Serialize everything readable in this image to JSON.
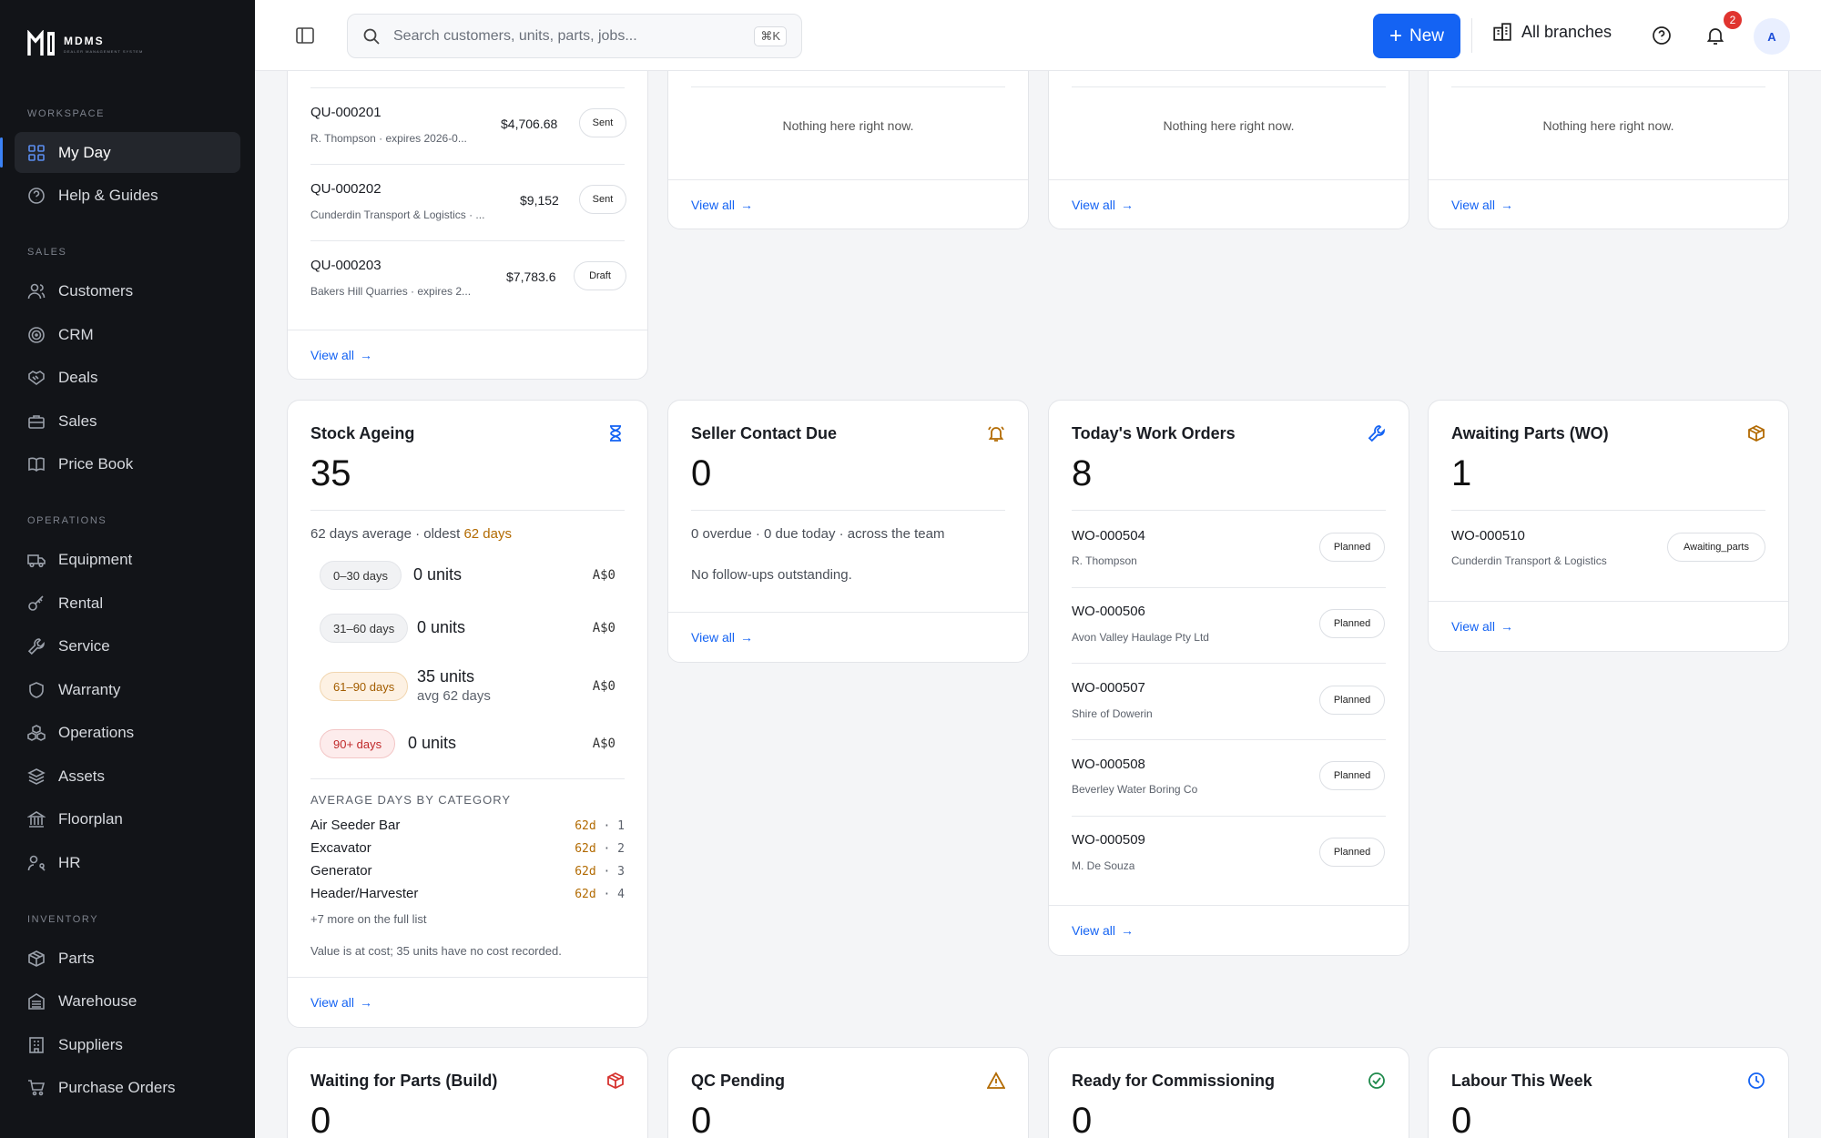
{
  "brand": {
    "name": "MDMS",
    "tagline": "DEALER MANAGEMENT SYSTEM"
  },
  "sidebar": {
    "sections": [
      {
        "label": "WORKSPACE",
        "items": [
          {
            "label": "My Day",
            "icon": "grid-icon",
            "active": true
          },
          {
            "label": "Help & Guides",
            "icon": "help-circle-icon"
          }
        ]
      },
      {
        "label": "SALES",
        "items": [
          {
            "label": "Customers",
            "icon": "users-icon"
          },
          {
            "label": "CRM",
            "icon": "target-icon"
          },
          {
            "label": "Deals",
            "icon": "handshake-icon"
          },
          {
            "label": "Sales",
            "icon": "briefcase-icon"
          },
          {
            "label": "Price Book",
            "icon": "book-icon"
          }
        ]
      },
      {
        "label": "OPERATIONS",
        "items": [
          {
            "label": "Equipment",
            "icon": "truck-icon"
          },
          {
            "label": "Rental",
            "icon": "key-icon"
          },
          {
            "label": "Service",
            "icon": "wrench-icon"
          },
          {
            "label": "Warranty",
            "icon": "shield-icon"
          },
          {
            "label": "Operations",
            "icon": "cubes-icon"
          },
          {
            "label": "Assets",
            "icon": "layers-icon"
          },
          {
            "label": "Floorplan",
            "icon": "bank-icon"
          },
          {
            "label": "HR",
            "icon": "user-key-icon"
          }
        ]
      },
      {
        "label": "INVENTORY",
        "items": [
          {
            "label": "Parts",
            "icon": "package-icon"
          },
          {
            "label": "Warehouse",
            "icon": "warehouse-icon"
          },
          {
            "label": "Suppliers",
            "icon": "building-icon"
          },
          {
            "label": "Purchase Orders",
            "icon": "cart-icon"
          }
        ]
      }
    ]
  },
  "topbar": {
    "search_placeholder": "Search customers, units, parts, jobs...",
    "search_shortcut": "⌘K",
    "new_label": "New",
    "branches_label": "All branches",
    "notifications_count": "2",
    "avatar_initial": "A"
  },
  "quotes_card": {
    "rows": [
      {
        "id": "QU-000201",
        "sub": "R. Thompson · expires 2026-0...",
        "amount": "$4,706.68",
        "status": "Sent"
      },
      {
        "id": "QU-000202",
        "sub": "Cunderdin Transport & Logistics · ...",
        "amount": "$9,152",
        "status": "Sent"
      },
      {
        "id": "QU-000203",
        "sub": "Bakers Hill Quarries · expires 2...",
        "amount": "$7,783.6",
        "status": "Draft"
      }
    ],
    "view_all": "View all"
  },
  "empty_cards": [
    {
      "message": "Nothing here right now.",
      "view_all": "View all"
    },
    {
      "message": "Nothing here right now.",
      "view_all": "View all"
    },
    {
      "message": "Nothing here right now.",
      "view_all": "View all"
    }
  ],
  "stock_ageing": {
    "title": "Stock Ageing",
    "count": "35",
    "summary_prefix": "62 days average · oldest ",
    "summary_highlight": "62 days",
    "buckets": [
      {
        "range": "0–30 days",
        "units": "0 units",
        "sub": "",
        "value": "A$0",
        "tone": "neutral"
      },
      {
        "range": "31–60 days",
        "units": "0 units",
        "sub": "",
        "value": "A$0",
        "tone": "neutral"
      },
      {
        "range": "61–90 days",
        "units": "35 units",
        "sub": "avg 62 days",
        "value": "A$0",
        "tone": "amber"
      },
      {
        "range": "90+ days",
        "units": "0 units",
        "sub": "",
        "value": "A$0",
        "tone": "red"
      }
    ],
    "category_heading": "AVERAGE DAYS BY CATEGORY",
    "categories": [
      {
        "name": "Air Seeder Bar",
        "days": "62d",
        "count": "1"
      },
      {
        "name": "Excavator",
        "days": "62d",
        "count": "2"
      },
      {
        "name": "Generator",
        "days": "62d",
        "count": "3"
      },
      {
        "name": "Header/Harvester",
        "days": "62d",
        "count": "4"
      }
    ],
    "more_text": "+7 more on the full list",
    "footnote": "Value is at cost; 35 units have no cost recorded.",
    "view_all": "View all"
  },
  "seller_contact": {
    "title": "Seller Contact Due",
    "count": "0",
    "summary": "0 overdue · 0 due today · across the team",
    "message": "No follow-ups outstanding.",
    "view_all": "View all"
  },
  "work_orders": {
    "title": "Today's Work Orders",
    "count": "8",
    "rows": [
      {
        "id": "WO-000504",
        "sub": "R. Thompson",
        "status": "Planned"
      },
      {
        "id": "WO-000506",
        "sub": "Avon Valley Haulage Pty Ltd",
        "status": "Planned"
      },
      {
        "id": "WO-000507",
        "sub": "Shire of Dowerin",
        "status": "Planned"
      },
      {
        "id": "WO-000508",
        "sub": "Beverley Water Boring Co",
        "status": "Planned"
      },
      {
        "id": "WO-000509",
        "sub": "M. De Souza",
        "status": "Planned"
      }
    ],
    "view_all": "View all"
  },
  "awaiting_parts": {
    "title": "Awaiting Parts (WO)",
    "count": "1",
    "rows": [
      {
        "id": "WO-000510",
        "sub": "Cunderdin Transport & Logistics",
        "status": "Awaiting_parts"
      }
    ],
    "view_all": "View all"
  },
  "bottom_cards": [
    {
      "title": "Waiting for Parts (Build)",
      "count": "0",
      "icon": "package-icon"
    },
    {
      "title": "QC Pending",
      "count": "0",
      "icon": "warning-icon"
    },
    {
      "title": "Ready for Commissioning",
      "count": "0",
      "icon": "check-circle-icon"
    },
    {
      "title": "Labour This Week",
      "count": "0",
      "icon": "clock-icon"
    }
  ],
  "colors": {
    "accent": "#1463f3",
    "sidebar_bg": "#121418",
    "amber": "#b26a00",
    "red": "#d6332f",
    "green": "#1f8a4c"
  }
}
